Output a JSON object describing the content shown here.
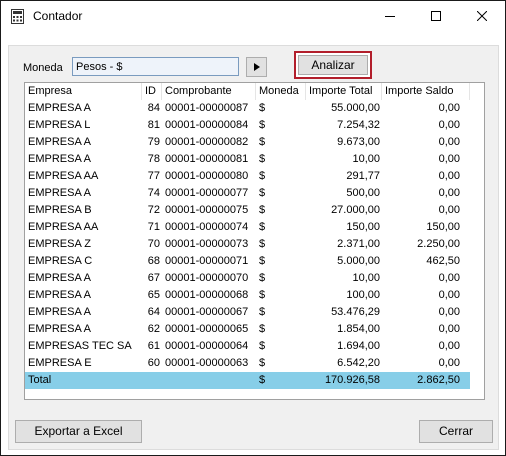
{
  "window": {
    "title": "Contador"
  },
  "toolbar": {
    "moneda_label": "Moneda",
    "moneda_value": "Pesos - $",
    "analizar_label": "Analizar"
  },
  "grid": {
    "headers": [
      "Empresa",
      "ID",
      "Comprobante",
      "Moneda",
      "Importe Total",
      "Importe Saldo"
    ],
    "rows": [
      [
        "EMPRESA A",
        "84",
        "00001-00000087",
        "$",
        "55.000,00",
        "0,00"
      ],
      [
        "EMPRESA L",
        "81",
        "00001-00000084",
        "$",
        "7.254,32",
        "0,00"
      ],
      [
        "EMPRESA A",
        "79",
        "00001-00000082",
        "$",
        "9.673,00",
        "0,00"
      ],
      [
        "EMPRESA A",
        "78",
        "00001-00000081",
        "$",
        "10,00",
        "0,00"
      ],
      [
        "EMPRESA AA",
        "77",
        "00001-00000080",
        "$",
        "291,77",
        "0,00"
      ],
      [
        "EMPRESA A",
        "74",
        "00001-00000077",
        "$",
        "500,00",
        "0,00"
      ],
      [
        "EMPRESA B",
        "72",
        "00001-00000075",
        "$",
        "27.000,00",
        "0,00"
      ],
      [
        "EMPRESA AA",
        "71",
        "00001-00000074",
        "$",
        "150,00",
        "150,00"
      ],
      [
        "EMPRESA Z",
        "70",
        "00001-00000073",
        "$",
        "2.371,00",
        "2.250,00"
      ],
      [
        "EMPRESA C",
        "68",
        "00001-00000071",
        "$",
        "5.000,00",
        "462,50"
      ],
      [
        "EMPRESA A",
        "67",
        "00001-00000070",
        "$",
        "10,00",
        "0,00"
      ],
      [
        "EMPRESA A",
        "65",
        "00001-00000068",
        "$",
        "100,00",
        "0,00"
      ],
      [
        "EMPRESA A",
        "64",
        "00001-00000067",
        "$",
        "53.476,29",
        "0,00"
      ],
      [
        "EMPRESA A",
        "62",
        "00001-00000065",
        "$",
        "1.854,00",
        "0,00"
      ],
      [
        "EMPRESAS TEC SA",
        "61",
        "00001-00000064",
        "$",
        "1.694,00",
        "0,00"
      ],
      [
        "EMPRESA E",
        "60",
        "00001-00000063",
        "$",
        "6.542,20",
        "0,00"
      ]
    ],
    "total": [
      "Total",
      "",
      "",
      "$",
      "170.926,58",
      "2.862,50"
    ],
    "total_color": "#87cee8"
  },
  "footer": {
    "export_label": "Exportar a Excel",
    "close_label": "Cerrar"
  },
  "icons": {
    "app": "calculator-icon",
    "minimize": "minimize-icon",
    "maximize": "maximize-icon",
    "close": "close-icon",
    "moneda_button": "play-icon"
  }
}
